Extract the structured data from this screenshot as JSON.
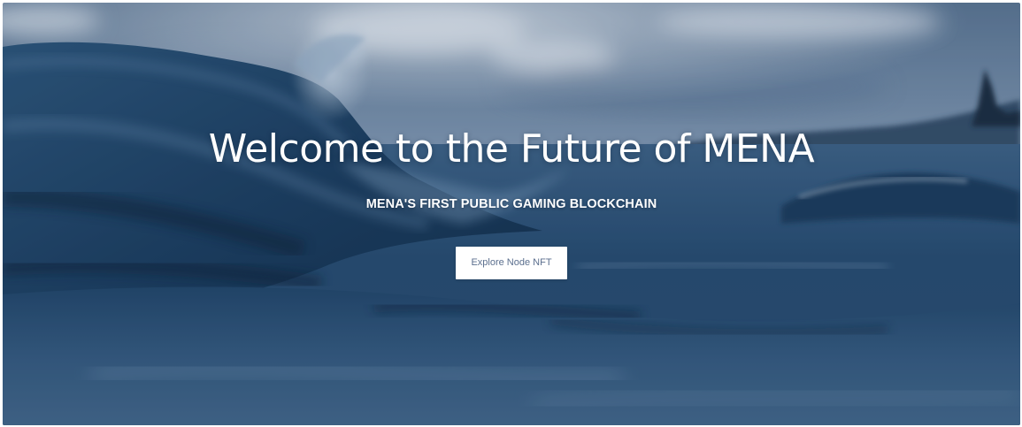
{
  "hero": {
    "title": "Welcome to the Future of MENA",
    "subtitle": "MENA'S FIRST PUBLIC GAMING BLOCKCHAIN",
    "cta_label": "Explore Node NFT",
    "background_image": "ocean-wave-under-cloudy-sky",
    "colors": {
      "text": "#ffffff",
      "button_bg": "#ffffff",
      "button_text": "#5b6f8e",
      "water_dark": "#0f2a44",
      "sky": "#7f97b4"
    }
  }
}
